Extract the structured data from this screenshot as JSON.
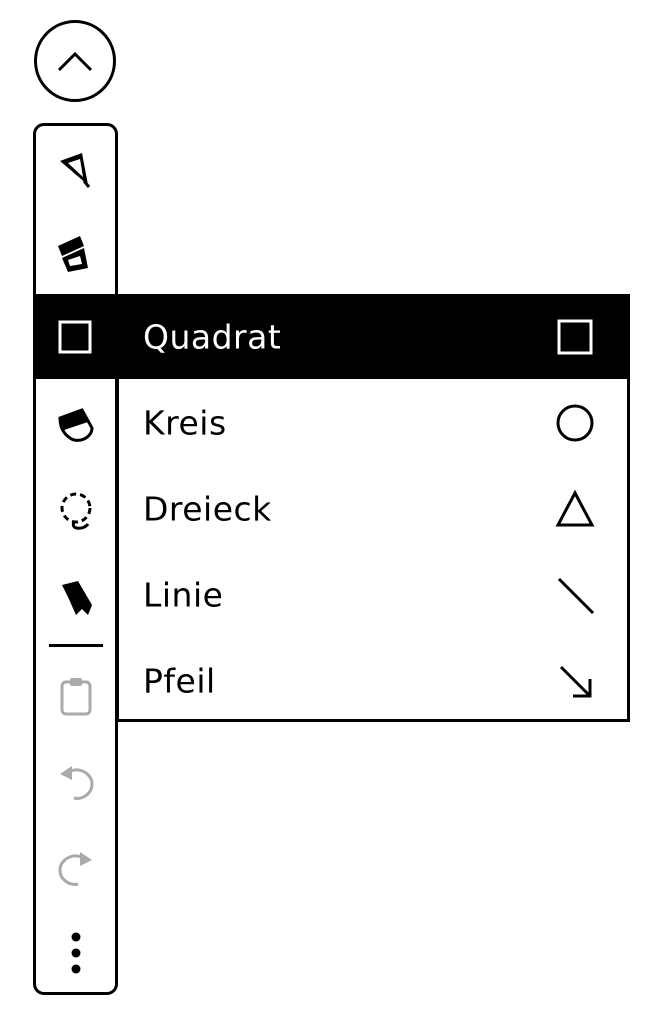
{
  "toolbar": {
    "collapse_icon": "chevron-up-icon",
    "tools": [
      {
        "name": "pen-tool",
        "icon": "pen-icon",
        "enabled": true
      },
      {
        "name": "highlighter-tool",
        "icon": "highlighter-icon",
        "enabled": true
      },
      {
        "name": "shape-tool",
        "icon": "square-icon",
        "enabled": true,
        "selected": true
      },
      {
        "name": "eraser-tool",
        "icon": "eraser-icon",
        "enabled": true
      },
      {
        "name": "lasso-tool",
        "icon": "lasso-icon",
        "enabled": true
      },
      {
        "name": "pointer-tool",
        "icon": "pointer-icon",
        "enabled": true
      },
      {
        "name": "paste-tool",
        "icon": "clipboard-icon",
        "enabled": false
      },
      {
        "name": "undo-tool",
        "icon": "undo-icon",
        "enabled": false
      },
      {
        "name": "redo-tool",
        "icon": "redo-icon",
        "enabled": false
      },
      {
        "name": "more-tool",
        "icon": "more-vertical-icon",
        "enabled": true
      }
    ]
  },
  "shape_menu": {
    "items": [
      {
        "label": "Quadrat",
        "icon": "square-icon",
        "selected": true
      },
      {
        "label": "Kreis",
        "icon": "circle-icon",
        "selected": false
      },
      {
        "label": "Dreieck",
        "icon": "triangle-icon",
        "selected": false
      },
      {
        "label": "Linie",
        "icon": "line-icon",
        "selected": false
      },
      {
        "label": "Pfeil",
        "icon": "arrow-icon",
        "selected": false
      }
    ]
  },
  "colors": {
    "foreground": "#000000",
    "background": "#ffffff",
    "disabled": "#aaaaaa"
  }
}
